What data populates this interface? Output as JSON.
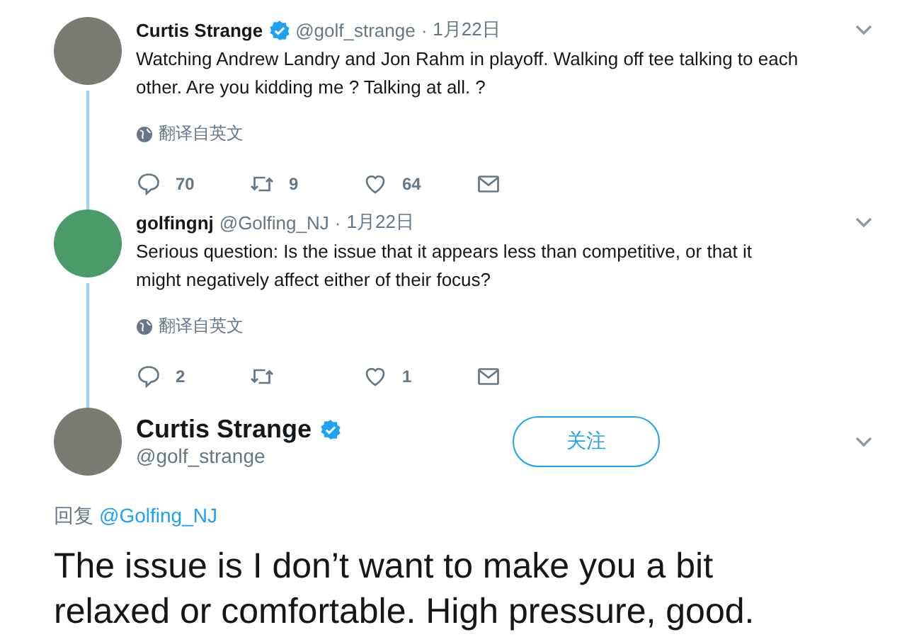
{
  "thread": [
    {
      "name": "Curtis Strange",
      "verified": true,
      "handle": "@golf_strange",
      "separator": "·",
      "date": "1月22日",
      "text": "Watching Andrew Landry and Jon Rahm in playoff. Walking off tee talking to each other. Are you kidding me ? Talking at all. ?",
      "translate": "翻译自英文",
      "replies": "70",
      "retweets": "9",
      "likes": "64"
    },
    {
      "name": "golfingnj",
      "verified": false,
      "handle": "@Golfing_NJ",
      "separator": "·",
      "date": "1月22日",
      "text": "Serious question: Is the issue that it appears less than competitive, or that it might negatively affect either of their focus?",
      "translate": "翻译自英文",
      "replies": "2",
      "likes": "1"
    }
  ],
  "main": {
    "name": "Curtis Strange",
    "verified": true,
    "handle": "@golf_strange",
    "follow": "关注",
    "reply_label": "回复",
    "reply_to": "@Golfing_NJ",
    "text": "The issue is I don’t want to make you a bit relaxed or comfortable. High pressure, good."
  }
}
